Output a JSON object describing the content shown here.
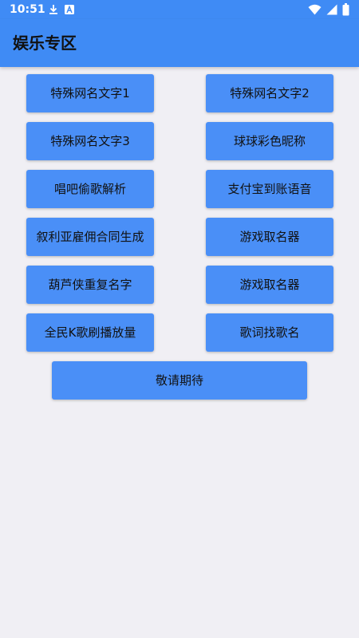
{
  "status_bar": {
    "time": "10:51",
    "left_icons": [
      "download-icon",
      "font-icon"
    ],
    "right_icons": [
      "wifi-icon",
      "cell-signal-icon",
      "battery-icon"
    ]
  },
  "app_bar": {
    "title": "娱乐专区"
  },
  "buttons": [
    {
      "label": "特殊网名文字1"
    },
    {
      "label": "特殊网名文字2"
    },
    {
      "label": "特殊网名文字3"
    },
    {
      "label": "球球彩色昵称"
    },
    {
      "label": "唱吧偷歌解析"
    },
    {
      "label": "支付宝到账语音"
    },
    {
      "label": "叙利亚雇佣合同生成"
    },
    {
      "label": "游戏取名器"
    },
    {
      "label": "葫芦侠重复名字"
    },
    {
      "label": "游戏取名器"
    },
    {
      "label": "全民K歌刷播放量"
    },
    {
      "label": "歌词找歌名"
    }
  ],
  "footer_button": {
    "label": "敬请期待"
  },
  "colors": {
    "primary": "#3f8bf5",
    "button": "#4a8ff7",
    "background": "#f0eff4"
  }
}
